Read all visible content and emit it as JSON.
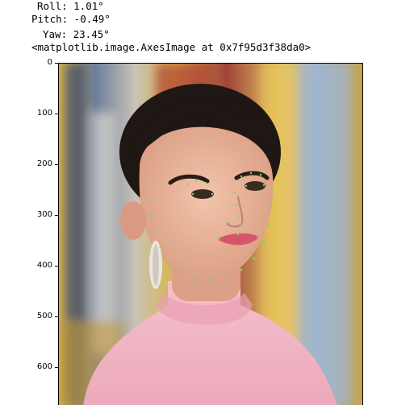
{
  "output": {
    "roll": "Roll: 1.01°",
    "pitch": "Pitch: -0.49°",
    "yaw": "Yaw: 23.45°",
    "repr": "<matplotlib.image.AxesImage at 0x7f95d3f38da0>"
  },
  "axes": {
    "y_ticks": [
      "0",
      "100",
      "200",
      "300",
      "400",
      "500",
      "600"
    ]
  },
  "image": {
    "subject": "portrait with facial landmark points",
    "colors": {
      "background_blue": "#8fa6c2",
      "background_yellow": "#d9b54a",
      "background_red": "#a0443a",
      "skin": "#e9b39a",
      "hair": "#1f1714",
      "sweater": "#f2b6c3",
      "lips": "#d8546a",
      "landmark": "#7ed957"
    }
  }
}
